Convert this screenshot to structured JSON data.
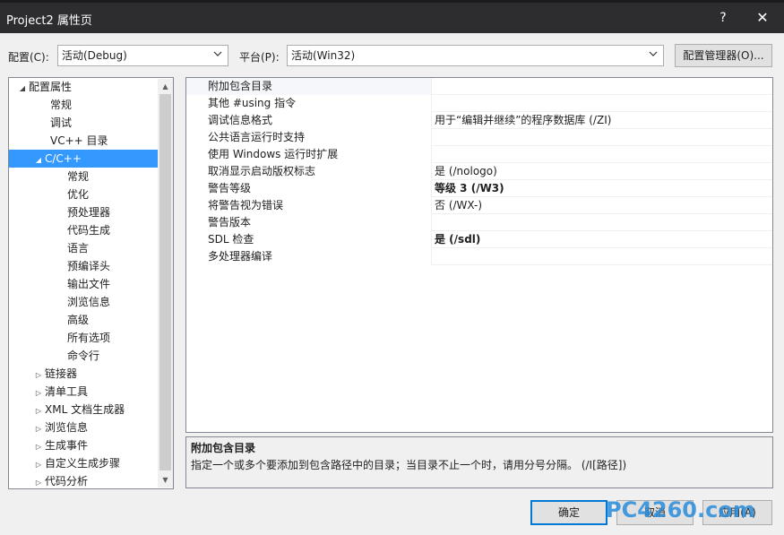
{
  "window": {
    "title": "Project2 属性页",
    "help": "?",
    "close": "✕"
  },
  "toolbar": {
    "config_label": "配置(C):",
    "config_value": "活动(Debug)",
    "platform_label": "平台(P):",
    "platform_value": "活动(Win32)",
    "manager_label": "配置管理器(O)..."
  },
  "tree": {
    "items": [
      {
        "label": "配置属性",
        "exp": "◢"
      },
      {
        "label": "常规"
      },
      {
        "label": "调试"
      },
      {
        "label": "VC++ 目录"
      },
      {
        "label": "C/C++",
        "exp": "◢"
      },
      {
        "label": "常规"
      },
      {
        "label": "优化"
      },
      {
        "label": "预处理器"
      },
      {
        "label": "代码生成"
      },
      {
        "label": "语言"
      },
      {
        "label": "预编译头"
      },
      {
        "label": "输出文件"
      },
      {
        "label": "浏览信息"
      },
      {
        "label": "高级"
      },
      {
        "label": "所有选项"
      },
      {
        "label": "命令行"
      },
      {
        "label": "链接器",
        "exp": "▷"
      },
      {
        "label": "清单工具",
        "exp": "▷"
      },
      {
        "label": "XML 文档生成器",
        "exp": "▷"
      },
      {
        "label": "浏览信息",
        "exp": "▷"
      },
      {
        "label": "生成事件",
        "exp": "▷"
      },
      {
        "label": "自定义生成步骤",
        "exp": "▷"
      },
      {
        "label": "代码分析",
        "exp": "▷"
      }
    ]
  },
  "properties": [
    {
      "name": "附加包含目录",
      "value": ""
    },
    {
      "name": "其他 #using 指令",
      "value": ""
    },
    {
      "name": "调试信息格式",
      "value": "用于“编辑并继续”的程序数据库 (/ZI)"
    },
    {
      "name": "公共语言运行时支持",
      "value": ""
    },
    {
      "name": "使用 Windows 运行时扩展",
      "value": ""
    },
    {
      "name": "取消显示启动版权标志",
      "value": "是 (/nologo)"
    },
    {
      "name": "警告等级",
      "value": "等级 3 (/W3)"
    },
    {
      "name": "将警告视为错误",
      "value": "否 (/WX-)"
    },
    {
      "name": "警告版本",
      "value": ""
    },
    {
      "name": "SDL 检查",
      "value": "是 (/sdl)"
    },
    {
      "name": "多处理器编译",
      "value": ""
    }
  ],
  "description": {
    "title": "附加包含目录",
    "text": "指定一个或多个要添加到包含路径中的目录；当目录不止一个时，请用分号分隔。      (/I[路径])"
  },
  "buttons": {
    "ok": "确定",
    "cancel": "取消",
    "apply": "应用(A)"
  },
  "watermark": "PC4260.com"
}
